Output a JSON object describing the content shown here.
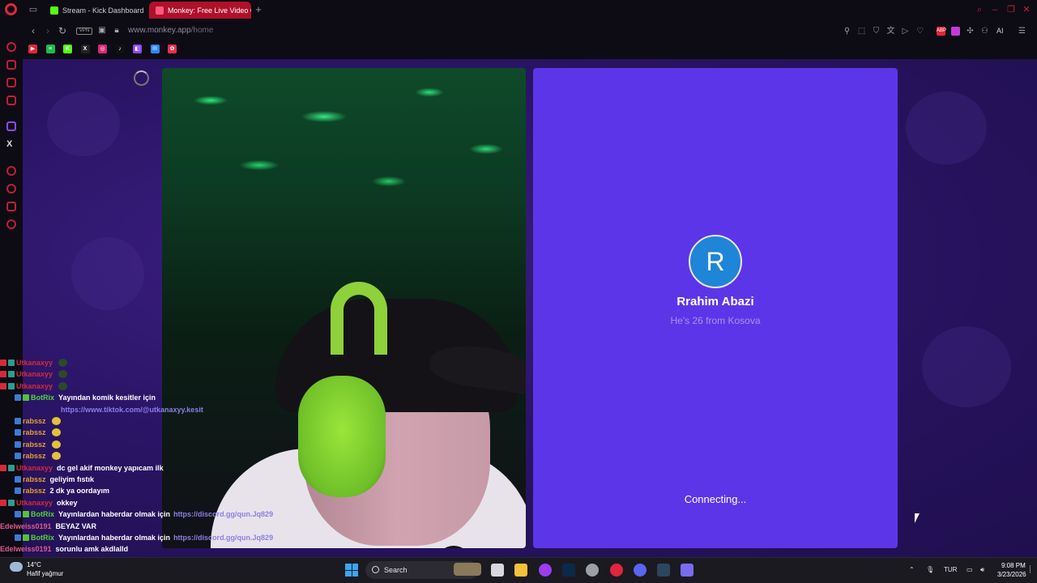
{
  "browser": {
    "tabs": [
      {
        "label": "Stream - Kick Dashboard",
        "favicon_color": "#53fc18"
      },
      {
        "label": "Monkey: Free Live Video C",
        "favicon_color": "#ff5a7a"
      }
    ],
    "new_tab_label": "+",
    "url_domain": "www.monkey.app",
    "url_path": "/home",
    "vpn_label": "VPN",
    "ai_label": "AI",
    "accent": "#b0102a"
  },
  "bookmarks": [
    {
      "name": "youtube",
      "color": "#e0263c",
      "glyph": "▶"
    },
    {
      "name": "spotify",
      "color": "#1db954",
      "glyph": "≡"
    },
    {
      "name": "kick",
      "color": "#53fc18",
      "glyph": "K"
    },
    {
      "name": "x",
      "color": "#222222",
      "glyph": "X"
    },
    {
      "name": "instagram",
      "color": "#d62976",
      "glyph": "◎"
    },
    {
      "name": "tiktok",
      "color": "#111111",
      "glyph": "♪"
    },
    {
      "name": "twitch",
      "color": "#9146ff",
      "glyph": "◧"
    },
    {
      "name": "messenger",
      "color": "#2d88ff",
      "glyph": "✉"
    },
    {
      "name": "app",
      "color": "#e8314b",
      "glyph": "✿"
    }
  ],
  "profile": {
    "initial": "R",
    "name": "Rrahim Abazi",
    "subtitle": "He's 26 from Kosova",
    "status": "Connecting..."
  },
  "chat": [
    {
      "user": "Utkanaxyy",
      "user_class": "u-red",
      "text": "",
      "emote": "dark",
      "link": ""
    },
    {
      "user": "Utkanaxyy",
      "user_class": "u-red",
      "text": "",
      "emote": "dark",
      "link": ""
    },
    {
      "user": "Utkanaxyy",
      "user_class": "u-red",
      "text": "",
      "emote": "dark",
      "link": ""
    },
    {
      "user": "BotRix",
      "user_class": "u-green",
      "text": "Yayından komik kesitler için",
      "emote": "",
      "link": ""
    },
    {
      "user": "",
      "user_class": "",
      "text": "",
      "emote": "",
      "link": "https://www.tiktok.com/@utkanaxyy.kesit"
    },
    {
      "user": "rabssz",
      "user_class": "u-orange",
      "text": "",
      "emote": "yellow",
      "link": ""
    },
    {
      "user": "rabssz",
      "user_class": "u-orange",
      "text": "",
      "emote": "yellow",
      "link": ""
    },
    {
      "user": "rabssz",
      "user_class": "u-orange",
      "text": "",
      "emote": "yellow",
      "link": ""
    },
    {
      "user": "rabssz",
      "user_class": "u-orange",
      "text": "",
      "emote": "yellow",
      "link": ""
    },
    {
      "user": "Utkanaxyy",
      "user_class": "u-red",
      "text": "dc gel akif monkey yapıcam ilk",
      "emote": "",
      "link": ""
    },
    {
      "user": "rabssz",
      "user_class": "u-orange",
      "text": "geliyim fıstık",
      "emote": "",
      "link": ""
    },
    {
      "user": "rabssz",
      "user_class": "u-orange",
      "text": "2 dk ya oordayım",
      "emote": "",
      "link": ""
    },
    {
      "user": "Utkanaxyy",
      "user_class": "u-red",
      "text": "okkey",
      "emote": "",
      "link": ""
    },
    {
      "user": "BotRix",
      "user_class": "u-green",
      "text": "Yayınlardan haberdar olmak için",
      "emote": "",
      "link": "https://discord.gg/qun.Jq829"
    },
    {
      "user": "Edelweiss0191",
      "user_class": "u-pink",
      "text": "BEYAZ VAR",
      "emote": "",
      "link": ""
    },
    {
      "user": "BotRix",
      "user_class": "u-green",
      "text": "Yayınlardan haberdar olmak için",
      "emote": "",
      "link": "https://discord.gg/qun.Jq829"
    },
    {
      "user": "Edelweiss0191",
      "user_class": "u-pink",
      "text": "sorunlu amk akdlalld",
      "emote": "",
      "link": ""
    }
  ],
  "taskbar": {
    "weather_temp": "14°C",
    "weather_desc": "Hafif yağmur",
    "search_label": "Search",
    "language": "TUR",
    "time": "9:08 PM",
    "date": "3/23/2026",
    "apps": [
      {
        "name": "task-view",
        "color": "#d8d8dc"
      },
      {
        "name": "file-explorer",
        "color": "#f3c13a"
      },
      {
        "name": "app-purple",
        "color": "#9b3cf0"
      },
      {
        "name": "photoshop",
        "color": "#0b2a4a"
      },
      {
        "name": "app-clock",
        "color": "#9aa0a8"
      },
      {
        "name": "opera",
        "color": "#e0263c"
      },
      {
        "name": "discord",
        "color": "#5865f2"
      },
      {
        "name": "steam",
        "color": "#2a475e"
      },
      {
        "name": "app-misc",
        "color": "#7a6cf0"
      }
    ]
  }
}
